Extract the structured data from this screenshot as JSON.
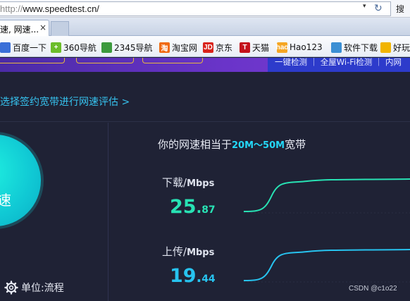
{
  "browser": {
    "address": {
      "scheme": "http://",
      "host": "www.speedtest.cn/",
      "side_text": "搜"
    },
    "tab": {
      "title": "速, 网速...",
      "close": "×"
    },
    "favorites": [
      {
        "label": "百度一下",
        "icon": "globe-icon",
        "color": "#3a6fd8",
        "glyph": ""
      },
      {
        "label": "360导航",
        "icon": "360-icon",
        "color": "#6cbd2a",
        "glyph": "+"
      },
      {
        "label": "2345导航",
        "icon": "2345-icon",
        "color": "#3d9a3d",
        "glyph": ""
      },
      {
        "label": "淘宝网",
        "icon": "taobao-icon",
        "color": "#f06a12",
        "glyph": "淘"
      },
      {
        "label": "京东",
        "icon": "jd-icon",
        "color": "#d9241c",
        "glyph": "JD"
      },
      {
        "label": "天猫",
        "icon": "tmall-icon",
        "color": "#c4121c",
        "glyph": "T"
      },
      {
        "label": "Hao123",
        "icon": "hao123-icon",
        "color": "#f5a623",
        "glyph": "hao"
      },
      {
        "label": "软件下载",
        "icon": "software-icon",
        "color": "#3b8fd4",
        "glyph": ""
      },
      {
        "label": "好玩",
        "icon": "game-icon",
        "color": "#f1b400",
        "glyph": ""
      }
    ]
  },
  "page": {
    "banner_right": "一键检测 ｜ 全屋Wi-Fi检测 ｜ 内网",
    "promo": "选择签约宽带进行网速评估 >",
    "gauge_label": "速",
    "settings_label": "单位:流程",
    "equivalent": {
      "prefix": "你的网速相当于",
      "value": "20M～50M",
      "suffix": "宽带"
    },
    "download": {
      "label": "下载/",
      "unit": "Mbps",
      "int": "25",
      "dot": ".",
      "dec": "87",
      "progress": 0.92
    },
    "upload": {
      "label": "上传/",
      "unit": "Mbps",
      "int": "19",
      "dot": ".",
      "dec": "44",
      "progress": 0.88
    },
    "watermark": "CSDN @c1o22"
  },
  "colors": {
    "background": "#1f2235",
    "accent_download": "#28e2b4",
    "accent_upload": "#27c3ef",
    "promo": "#36c3ef"
  }
}
